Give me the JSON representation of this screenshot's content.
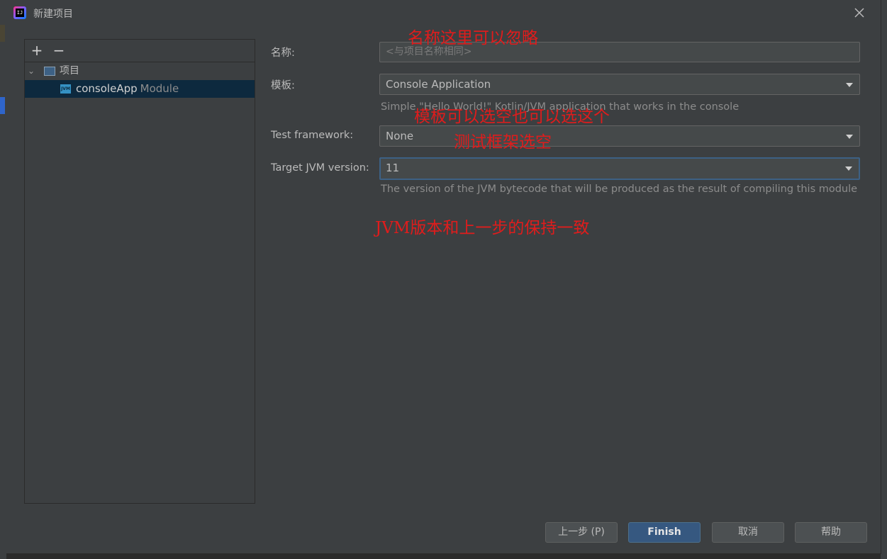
{
  "dialog": {
    "title": "新建项目",
    "close_icon": "close-icon"
  },
  "tree": {
    "toolbar": {
      "add_label": "+",
      "remove_label": "−"
    },
    "root": {
      "label": "项目",
      "icon": "folder-icon",
      "expanded": true
    },
    "module": {
      "name": "consoleApp",
      "suffix": "Module",
      "icon": "jvm-module-icon",
      "icon_text": "JVM"
    }
  },
  "form": {
    "name": {
      "label": "名称:",
      "value": "",
      "placeholder": "<与项目名称相同>"
    },
    "template": {
      "label": "模板:",
      "value": "Console Application",
      "hint": "Simple \"Hello World!\" Kotlin/JVM application that works in the console"
    },
    "test_framework": {
      "label": "Test framework:",
      "value": "None"
    },
    "target_jvm": {
      "label": "Target JVM version:",
      "value": "11",
      "hint": "The version of the JVM bytecode that will be produced as the result of compiling this module"
    }
  },
  "annotations": {
    "name_note": "名称这里可以忽略",
    "template_note": "模板可以选空也可以选这个",
    "test_note": "测试框架选空",
    "jvm_note": "JVM版本和上一步的保持一致"
  },
  "buttons": {
    "previous": "上一步 (P)",
    "finish": "Finish",
    "cancel": "取消",
    "help": "帮助"
  },
  "colors": {
    "dialog_bg": "#3c3f41",
    "selection_bg": "#0d293e",
    "primary_button": "#365880",
    "annotation_red": "#e01c1c"
  }
}
